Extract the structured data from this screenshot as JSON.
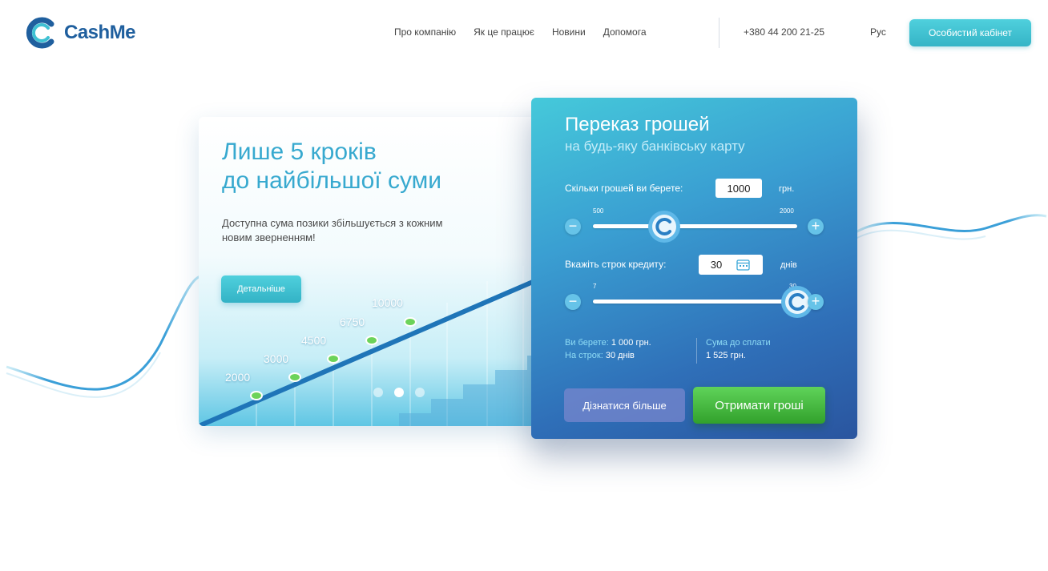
{
  "brand": {
    "name": "CashMe",
    "logo_icon": "cashme-logo-icon",
    "accent": "#3fc1d3",
    "brand_blue": "#1f5f9e"
  },
  "nav": {
    "items": [
      "Про компанію",
      "Як це працює",
      "Новини",
      "Допомога"
    ],
    "phone": "+380 44 200 21-25",
    "lang": "Рус",
    "cabinet_label": "Особистий кабінет"
  },
  "promo": {
    "title_line1": "Лише 5 кроків",
    "title_line2": "до найбільшої суми",
    "text_line1": "Доступна сума позики збільшується з кожним",
    "text_line2": "новим зверненням!",
    "details_label": "Детальніше",
    "step_values": [
      "2000",
      "3000",
      "4500",
      "6750",
      "10000"
    ],
    "slides": 3,
    "active_slide": 1
  },
  "calculator": {
    "title": "Переказ грошей",
    "subtitle": "на будь-яку банківську карту",
    "amount": {
      "label": "Скільки грошей ви берете:",
      "value": "1000",
      "unit": "грн.",
      "min": "500",
      "max": "2000",
      "level": 0.35
    },
    "term": {
      "label": "Вкажіть строк кредиту:",
      "value": "30",
      "unit": "днів",
      "min": "7",
      "max": "30",
      "level": 1.0,
      "calendar_icon": "calendar-icon"
    },
    "summary": {
      "take_label": "Ви берете:",
      "take_value": "1 000 грн.",
      "term_label": "На строк:",
      "term_value": "30 днів",
      "pay_label": "Сума до сплати",
      "pay_value": "1 525 грн."
    },
    "learn_more_label": "Дізнатися більше",
    "get_money_label": "Отримати гроші"
  }
}
